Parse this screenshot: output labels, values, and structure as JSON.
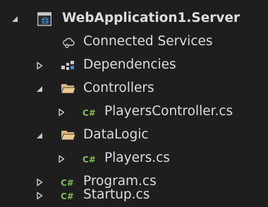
{
  "solution_explorer": {
    "project": {
      "label": "WebApplication1.Server",
      "expanded": true,
      "icon": "web-project-icon"
    },
    "items": [
      {
        "label": "Connected Services",
        "icon": "connected-services-icon",
        "expandable": false
      },
      {
        "label": "Dependencies",
        "icon": "dependencies-icon",
        "expandable": true,
        "expanded": false
      },
      {
        "label": "Controllers",
        "icon": "folder-icon",
        "expandable": true,
        "expanded": true
      },
      {
        "label": "PlayersController.cs",
        "icon": "csharp-file-icon",
        "file_badge": "C#",
        "expandable": true,
        "expanded": false
      },
      {
        "label": "DataLogic",
        "icon": "folder-icon",
        "expandable": true,
        "expanded": true
      },
      {
        "label": "Players.cs",
        "icon": "csharp-file-icon",
        "file_badge": "C#",
        "expandable": true,
        "expanded": false
      },
      {
        "label": "Program.cs",
        "icon": "csharp-file-icon",
        "file_badge": "C#",
        "expandable": true,
        "expanded": false
      },
      {
        "label": "Startup.cs",
        "icon": "csharp-file-icon",
        "file_badge": "C#",
        "expandable": true,
        "expanded": false
      }
    ]
  },
  "colors": {
    "background": "#1e1e1e",
    "text": "#dcdcdc",
    "arrow": "#c8c8c8",
    "folder": "#dcb67a",
    "csharp": "#7ec04f",
    "project_blue": "#3b8fd6"
  }
}
